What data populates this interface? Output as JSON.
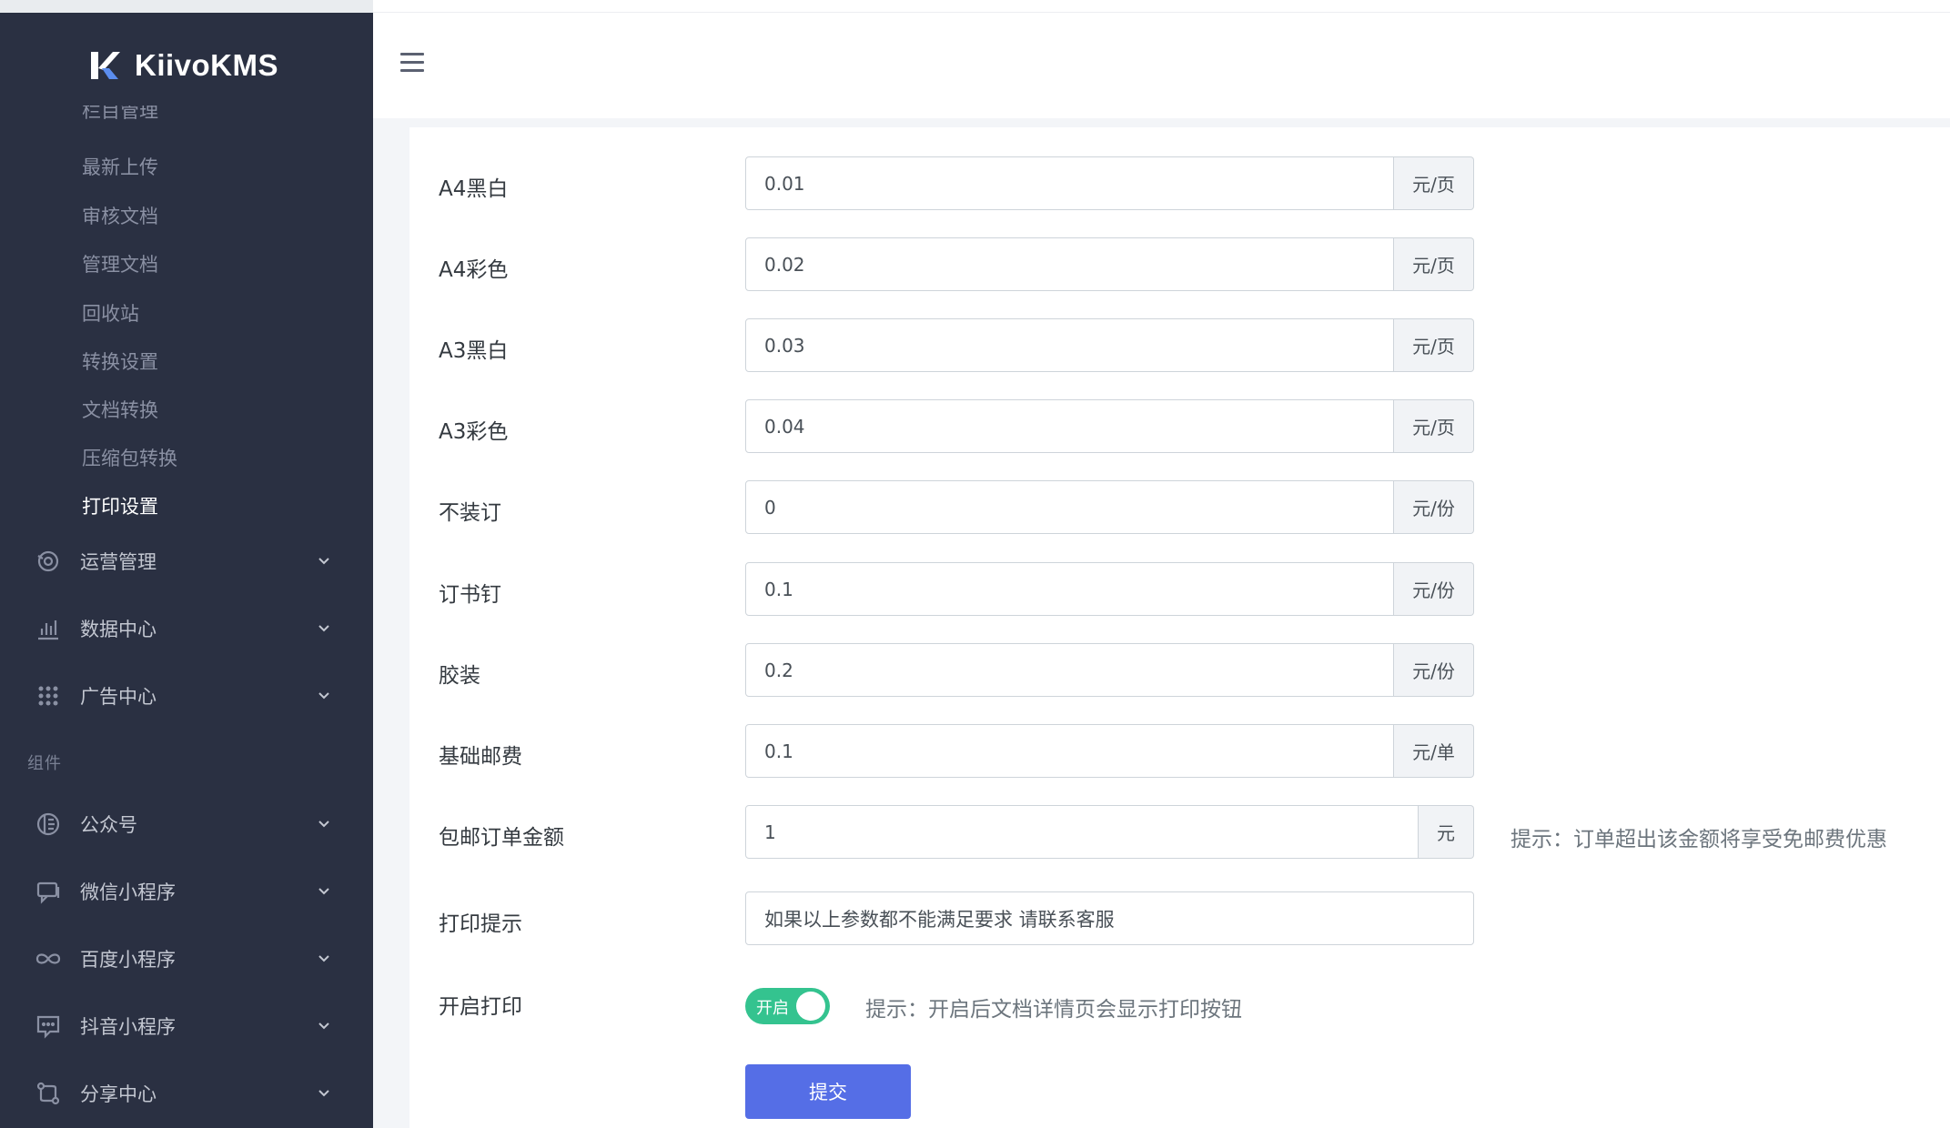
{
  "app": {
    "name": "KiivoKMS"
  },
  "sidebar": {
    "clipped_item": "栏目管理",
    "sub_items": [
      {
        "label": "最新上传"
      },
      {
        "label": "审核文档"
      },
      {
        "label": "管理文档"
      },
      {
        "label": "回收站"
      },
      {
        "label": "转换设置"
      },
      {
        "label": "文档转换"
      },
      {
        "label": "压缩包转换"
      },
      {
        "label": "打印设置",
        "active": true
      }
    ],
    "menus": [
      {
        "label": "运营管理",
        "icon": "operations-icon"
      },
      {
        "label": "数据中心",
        "icon": "bar-chart-icon"
      },
      {
        "label": "广告中心",
        "icon": "grid-dots-icon"
      }
    ],
    "section_title": "组件",
    "component_menus": [
      {
        "label": "公众号",
        "icon": "official-account-icon"
      },
      {
        "label": "微信小程序",
        "icon": "chat-icon"
      },
      {
        "label": "百度小程序",
        "icon": "infinity-icon"
      },
      {
        "label": "抖音小程序",
        "icon": "message-box-icon"
      },
      {
        "label": "分享中心",
        "icon": "share-icon"
      }
    ]
  },
  "form": {
    "rows": [
      {
        "label": "A4黑白",
        "value": "0.01",
        "unit": "元/页"
      },
      {
        "label": "A4彩色",
        "value": "0.02",
        "unit": "元/页"
      },
      {
        "label": "A3黑白",
        "value": "0.03",
        "unit": "元/页"
      },
      {
        "label": "A3彩色",
        "value": "0.04",
        "unit": "元/页"
      },
      {
        "label": "不装订",
        "value": "0",
        "unit": "元/份"
      },
      {
        "label": "订书钉",
        "value": "0.1",
        "unit": "元/份"
      },
      {
        "label": "胶装",
        "value": "0.2",
        "unit": "元/份"
      },
      {
        "label": "基础邮费",
        "value": "0.1",
        "unit": "元/单"
      },
      {
        "label": "包邮订单金额",
        "value": "1",
        "unit": "元",
        "hint": "提示：订单超出该金额将享受免邮费优惠"
      }
    ],
    "print_tip": {
      "label": "打印提示",
      "value": "如果以上参数都不能满足要求 请联系客服"
    },
    "enable_print": {
      "label": "开启打印",
      "switch_text": "开启",
      "on": true,
      "hint": "提示：开启后文档详情页会显示打印按钮"
    },
    "submit_label": "提交"
  },
  "colors": {
    "sidebar_bg": "#2a3042",
    "switch_on": "#34c38f",
    "primary": "#556ee6"
  }
}
